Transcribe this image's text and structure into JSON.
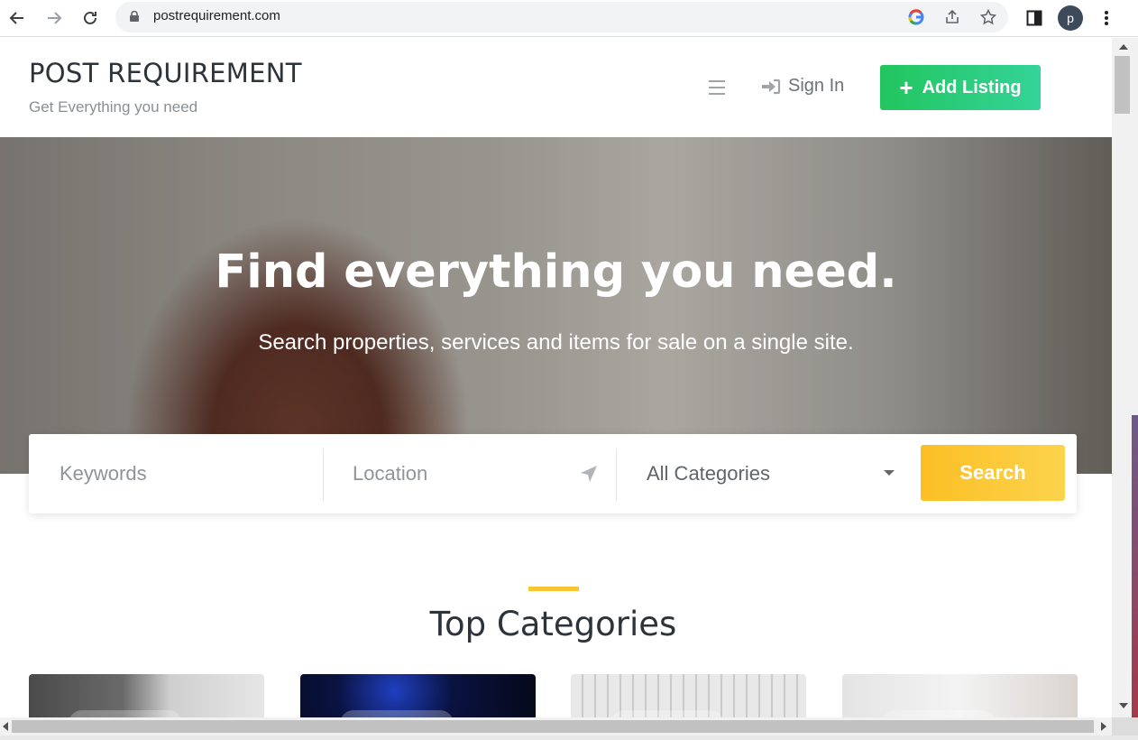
{
  "browser": {
    "url": "postrequirement.com",
    "profile_initial": "p"
  },
  "header": {
    "logo_title": "POST REQUIREMENT",
    "logo_tagline": "Get Everything you need",
    "signin_label": "Sign In",
    "add_listing_label": "Add Listing"
  },
  "hero": {
    "title": "Find everything you need.",
    "subtitle": "Search properties, services and items for sale on a single site."
  },
  "search": {
    "keywords_placeholder": "Keywords",
    "location_placeholder": "Location",
    "category_selected": "All Categories",
    "button_label": "Search"
  },
  "categories": {
    "title": "Top Categories"
  },
  "colors": {
    "accent_green": "#22c55e",
    "accent_yellow": "#fbbf24",
    "heading": "#2c333a"
  }
}
